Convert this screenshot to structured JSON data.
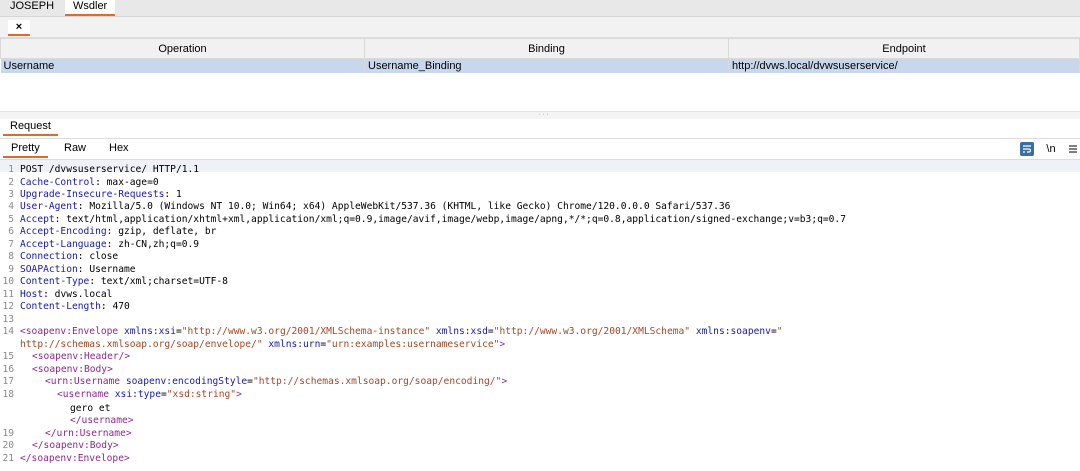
{
  "top_tabs": [
    "JOSEPH",
    "Wsdler"
  ],
  "close_tab_glyph": "×",
  "operations": {
    "headers": [
      "Operation",
      "Binding",
      "Endpoint"
    ],
    "rows": [
      {
        "operation": "Username",
        "binding": "Username_Binding",
        "endpoint": "http://dvws.local/dvwsuserservice/"
      }
    ]
  },
  "request": {
    "title": "Request",
    "view_tabs": [
      "Pretty",
      "Raw",
      "Hex"
    ],
    "toolbar": {
      "wrap_icon": "wrap-lines-icon",
      "newline_label": "\\n",
      "menu_icon": "hamburger-menu-icon"
    },
    "lines": [
      {
        "n": "1",
        "text": "POST /dvwsuserservice/ HTTP/1.1"
      },
      {
        "n": "2",
        "key": "Cache-Control",
        "val": "max-age=0"
      },
      {
        "n": "3",
        "key": "Upgrade-Insecure-Requests",
        "val": "1"
      },
      {
        "n": "4",
        "key": "User-Agent",
        "val": "Mozilla/5.0 (Windows NT 10.0; Win64; x64) AppleWebKit/537.36 (KHTML, like Gecko) Chrome/120.0.0.0 Safari/537.36"
      },
      {
        "n": "5",
        "key": "Accept",
        "val": "text/html,application/xhtml+xml,application/xml;q=0.9,image/avif,image/webp,image/apng,*/*;q=0.8,application/signed-exchange;v=b3;q=0.7"
      },
      {
        "n": "6",
        "key": "Accept-Encoding",
        "val": "gzip, deflate, br"
      },
      {
        "n": "7",
        "key": "Accept-Language",
        "val": "zh-CN,zh;q=0.9"
      },
      {
        "n": "8",
        "key": "Connection",
        "val": "close"
      },
      {
        "n": "9",
        "key": "SOAPAction",
        "val": "Username"
      },
      {
        "n": "10",
        "key": "Content-Type",
        "val": "text/xml;charset=UTF-8"
      },
      {
        "n": "11",
        "key": "Host",
        "val": "dvws.local"
      },
      {
        "n": "12",
        "key": "Content-Length",
        "val": "470"
      },
      {
        "n": "13",
        "text": ""
      }
    ],
    "xml": {
      "l14_n": "14",
      "l14_tag": "<soapenv:Envelope",
      "l14_attr1": "xmlns:xsi",
      "l14_val1": "\"http://www.w3.org/2001/XMLSchema-instance\"",
      "l14_attr2": "xmlns:xsd",
      "l14_val2": "\"http://www.w3.org/2001/XMLSchema\"",
      "l14_attr3": "xmlns:soapenv",
      "l14_val3a": "\"",
      "l14b_val3b": "http://schemas.xmlsoap.org/soap/envelope/\"",
      "l14b_attr4": "xmlns:urn",
      "l14b_val4": "\"urn:examples:usernameservice\"",
      "l14b_close": ">",
      "l15_n": "15",
      "l15": "<soapenv:Header/>",
      "l16_n": "16",
      "l16": "<soapenv:Body>",
      "l17_n": "17",
      "l17_tag": "<urn:Username",
      "l17_attr": "soapenv:encodingStyle",
      "l17_val": "\"http://schemas.xmlsoap.org/soap/encoding/\"",
      "l17_close": ">",
      "l18_n": "18",
      "l18_tag": "<username",
      "l18_attr": "xsi:type",
      "l18_val": "\"xsd:string\"",
      "l18_close": ">",
      "l18b_text": "gero et",
      "l18c": "</username>",
      "l19_n": "19",
      "l19": "</urn:Username>",
      "l20_n": "20",
      "l20": "</soapenv:Body>",
      "l21_n": "21",
      "l21": "</soapenv:Envelope>"
    }
  },
  "colors": {
    "accent": "#e06a2c",
    "selection": "#c9d7ee",
    "key": "#1a1aa6",
    "tag": "#8b2b8b",
    "string": "#a04a2a"
  }
}
